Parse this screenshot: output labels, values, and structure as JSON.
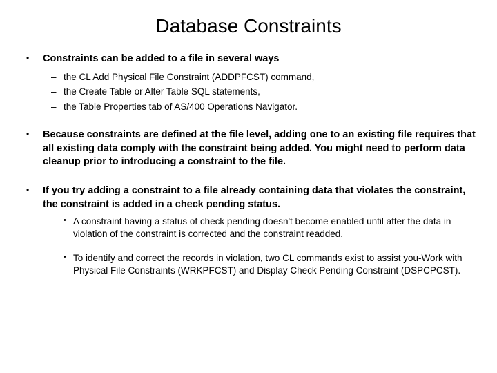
{
  "title": "Database Constraints",
  "bullets": [
    {
      "text": "Constraints can be added to a file in several ways",
      "bold": true,
      "sub_dash": [
        "the CL Add Physical File Constraint (ADDPFCST) command,",
        "the Create Table or Alter Table SQL statements,",
        "the Table Properties tab of AS/400 Operations Navigator."
      ]
    },
    {
      "text": "Because constraints are defined at the file level, adding one to an existing file requires that all existing data comply with the constraint being added. You might need to perform data cleanup prior to introducing a constraint to the file.",
      "bold": true
    },
    {
      "text": "If you try adding a constraint to a file already containing data that violates the constraint, the constraint is added in a check pending status.",
      "bold": true,
      "sub_bullet": [
        "A constraint having a status of check pending doesn't become enabled until after the data in violation of the constraint is corrected and the constraint readded.",
        "To identify and correct the records in violation, two CL commands exist to assist you-Work with Physical File Constraints (WRKPFCST) and Display Check Pending Constraint (DSPCPCST)."
      ]
    }
  ]
}
